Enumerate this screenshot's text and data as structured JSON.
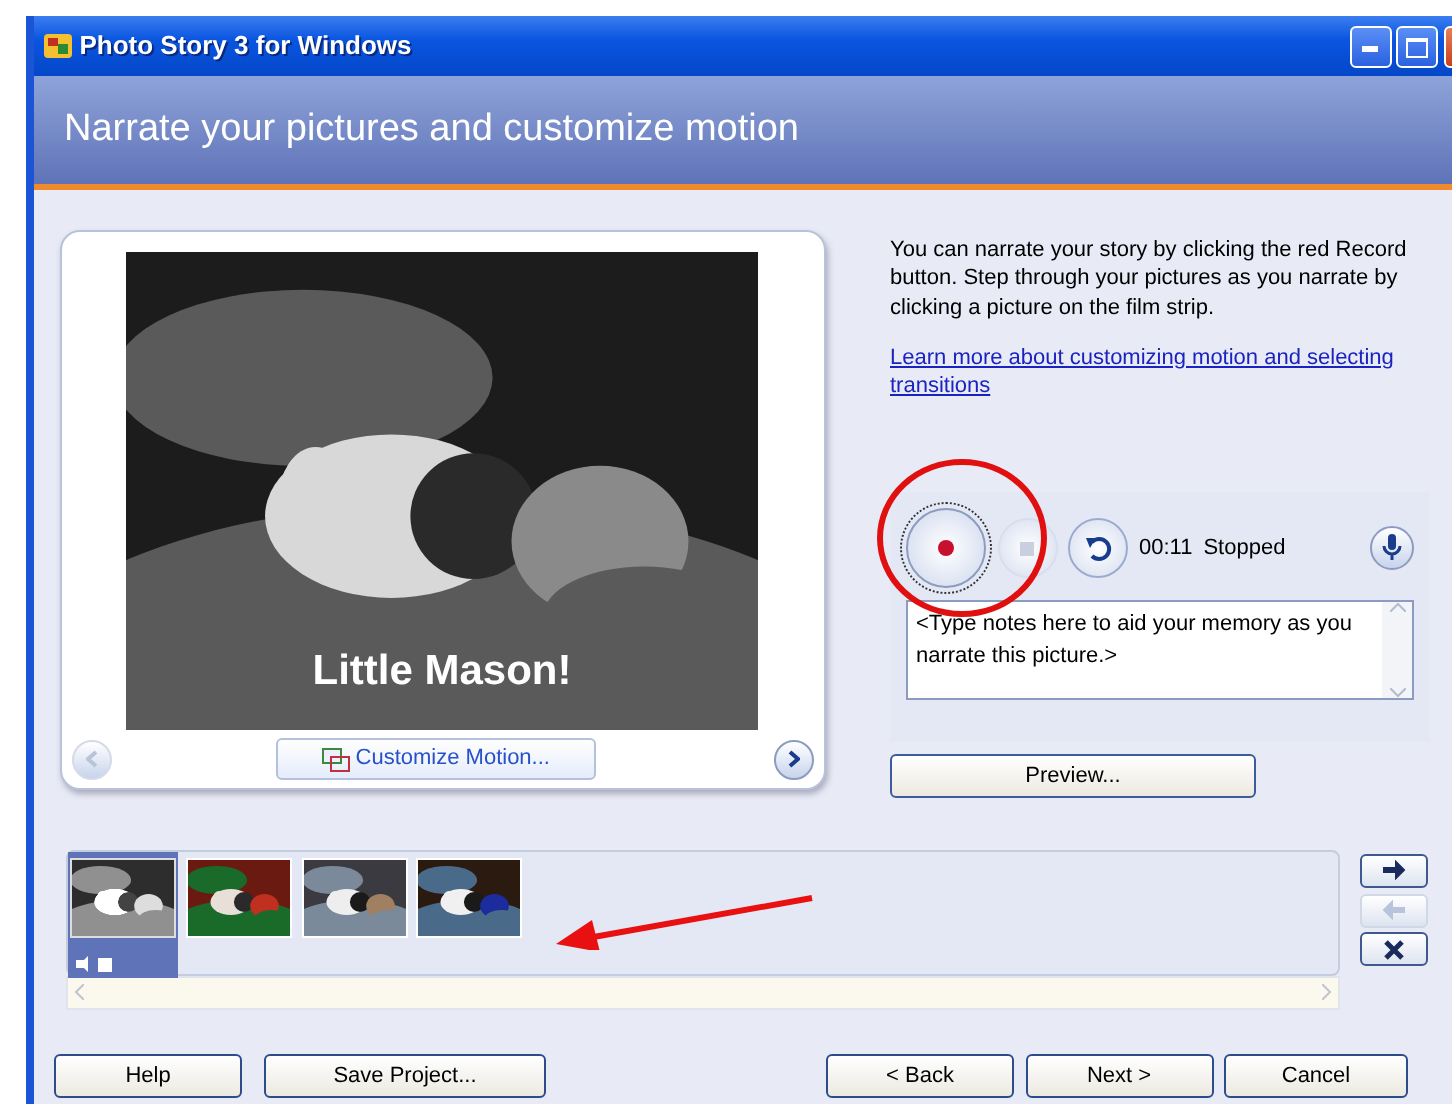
{
  "window": {
    "title": "Photo Story 3 for Windows"
  },
  "header": {
    "title": "Narrate your pictures and customize motion"
  },
  "preview": {
    "picture": {
      "kind": "picture"
    },
    "caption": "Little Mason!",
    "customize_button": "Customize Motion...",
    "prev_enabled": false,
    "next_enabled": true
  },
  "instructions": "You can narrate your story by clicking the red Record button. Step through your pictures as you narrate by clicking a picture on the film strip.",
  "help_link": "Learn more about customizing motion and selecting transitions",
  "narration": {
    "time": "00:11",
    "status": "Stopped",
    "stop_enabled": false,
    "notes_placeholder": "<Type notes here to aid your memory as you narrate this picture.>"
  },
  "preview_button": "Preview...",
  "filmstrip": {
    "thumbnails": [
      {
        "kind": "picture",
        "selected": true
      },
      {
        "kind": "picture",
        "selected": false
      },
      {
        "kind": "picture",
        "selected": false
      },
      {
        "kind": "picture",
        "selected": false
      }
    ]
  },
  "strip_buttons": [
    {
      "kind": "move-right",
      "enabled": true
    },
    {
      "kind": "move-left",
      "enabled": false
    },
    {
      "kind": "remove",
      "enabled": true
    }
  ],
  "footer": {
    "left_buttons": [
      "Help",
      "Save Project..."
    ],
    "right_buttons": [
      "< Back",
      "Next >",
      "Cancel"
    ]
  }
}
